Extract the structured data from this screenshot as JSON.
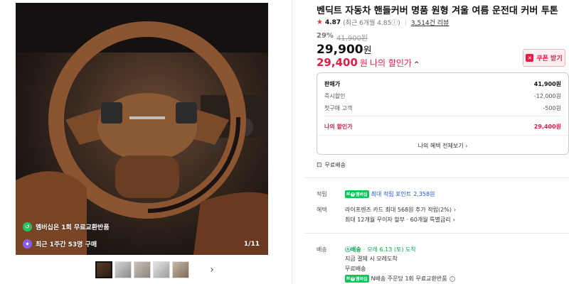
{
  "gallery": {
    "badge1": "멤버십은 1회 무료교환반품",
    "badge2": "최근 1주간 53명 구매",
    "counter": "1/11"
  },
  "product": {
    "title": "벤딕트 자동차 핸들커버 명품 원형 겨울 여름 운전대 커버 투톤",
    "rating": "4.87",
    "rating_meta": "(최근 6개월 4.85ⓘ)",
    "review_count": "3,514건 리뷰",
    "discount_pct": "29%",
    "original_price": "41,900원",
    "price": "29,900",
    "price_unit": "원",
    "my_price": "29,400",
    "my_price_unit": "원",
    "my_price_label": "나의 할인가",
    "coupon_label": "쿠폰 받기"
  },
  "breakdown": {
    "rows": [
      {
        "label": "판매가",
        "value": "41,900원"
      },
      {
        "label": "즉시할인",
        "value": "-12,000원"
      },
      {
        "label": "첫구매 고객",
        "value": "-500원"
      }
    ],
    "total_label": "나의 할인가",
    "total_value": "29,400원",
    "benefit_link": "나의 혜택 전체보기"
  },
  "delivery": {
    "free_shipping": "무료배송"
  },
  "points": {
    "label": "적립",
    "pill": "멤버십",
    "text": "최대 적립 포인트",
    "amount": "2,358원"
  },
  "benefits": {
    "label": "혜택",
    "line1": "라이프렌즈 카드 최대 568원 추가 적립(2%)",
    "line2": "최대 12개월 무이자 할부 · 60개월 특별금리"
  },
  "shipping": {
    "label": "배송",
    "pill": "배송",
    "eta": "모레 6.13 (토) 도착",
    "line2": "지금 결제 시 모레도착",
    "line3": "무료배송",
    "pill2": "멤버십",
    "line4": "N배송 주문당 1회 무료교환반품"
  },
  "colors": {
    "accent": "#e11d48",
    "naver_green": "#03c75a"
  }
}
